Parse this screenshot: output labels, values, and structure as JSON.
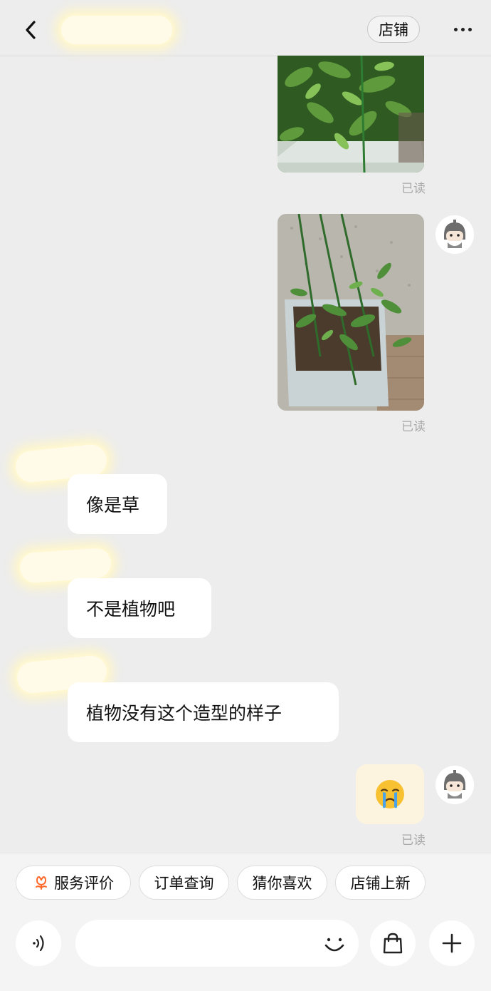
{
  "header": {
    "back_icon": "chevron-left-icon",
    "shop_label": "店铺",
    "more_icon": "more-dots-icon"
  },
  "messages": {
    "read_label_1": "已读",
    "read_label_2": "已读",
    "read_label_3": "已读",
    "incoming": [
      {
        "text": "像是草"
      },
      {
        "text": "不是植物吧"
      },
      {
        "text": "植物没有这个造型的样子"
      }
    ],
    "emoji": "😭"
  },
  "quick_actions": [
    {
      "label": "服务评价",
      "icon": "flower-icon"
    },
    {
      "label": "订单查询"
    },
    {
      "label": "猜你喜欢"
    },
    {
      "label": "店铺上新"
    }
  ],
  "input": {
    "placeholder": "",
    "voice_icon": "voice-icon",
    "emoji_icon": "smiley-icon",
    "bag_icon": "shopping-bag-icon",
    "plus_icon": "plus-icon"
  },
  "colors": {
    "background": "#ededed",
    "bubble_incoming": "#ffffff",
    "bubble_emoji": "#fdf4e0",
    "read_text": "#a8a8a8",
    "accent_icon": "#ff6a2b"
  }
}
